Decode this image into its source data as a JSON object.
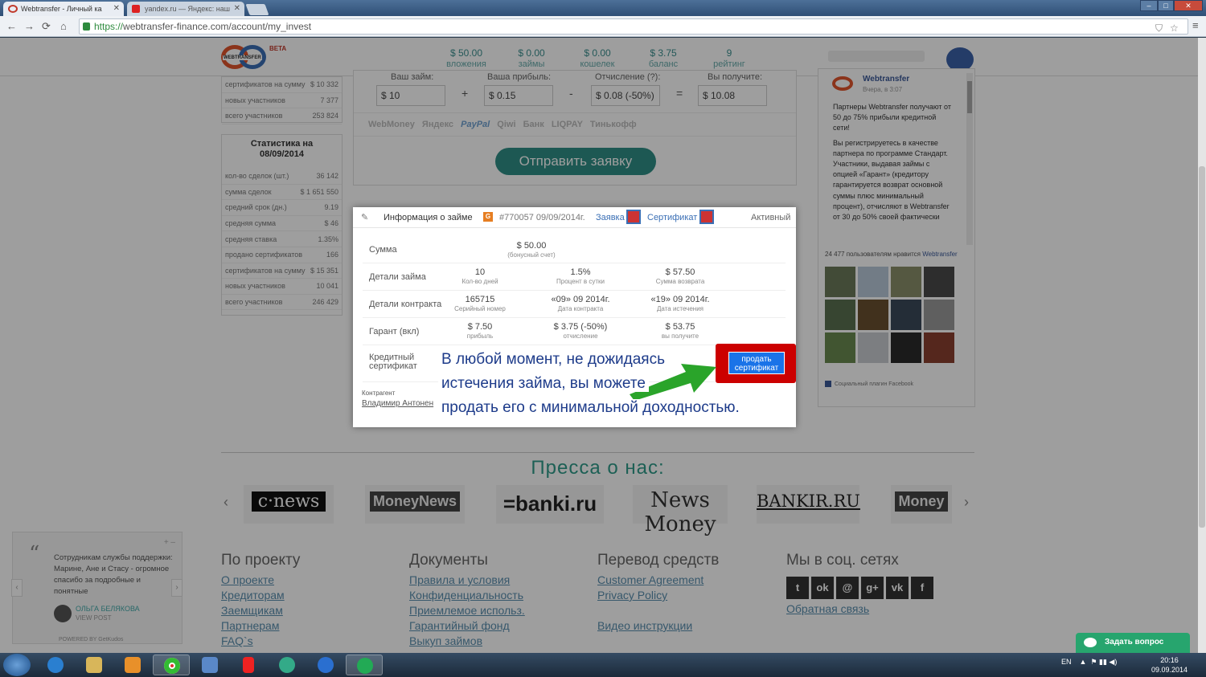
{
  "browser": {
    "tabs": [
      {
        "title": "Webtransfer - Личный ка"
      },
      {
        "title": "yandex.ru — Яндекс: наш"
      }
    ],
    "url_scheme": "https://",
    "url_rest": "webtransfer-finance.com/account/my_invest"
  },
  "header": {
    "logo_text": "WEBTRANSFER",
    "beta": "BETA",
    "stats": [
      {
        "value": "$ 50.00",
        "caption": "вложения"
      },
      {
        "value": "$ 0.00",
        "caption": "займы"
      },
      {
        "value": "$ 0.00",
        "caption": "кошелек"
      },
      {
        "value": "$ 3.75",
        "caption": "баланс"
      },
      {
        "value": "9",
        "caption": "рейтинг"
      }
    ]
  },
  "sidebar": {
    "top_rows": [
      {
        "label": "сертификатов на сумму",
        "value": "$ 10 332"
      },
      {
        "label": "новых участников",
        "value": "7 377"
      },
      {
        "label": "всего участников",
        "value": "253 824"
      }
    ],
    "stats_title": "Статистика на 08/09/2014",
    "rows": [
      {
        "label": "кол-во сделок (шт.)",
        "value": "36 142"
      },
      {
        "label": "сумма сделок",
        "value": "$ 1 651 550"
      },
      {
        "label": "средний срок (дн.)",
        "value": "9.19"
      },
      {
        "label": "средняя сумма",
        "value": "$ 46"
      },
      {
        "label": "средняя ставка",
        "value": "1.35%"
      },
      {
        "label": "продано сертификатов",
        "value": "166"
      },
      {
        "label": "сертификатов на сумму",
        "value": "$ 15 351"
      },
      {
        "label": "новых участников",
        "value": "10 041"
      },
      {
        "label": "всего участников",
        "value": "246 429"
      }
    ]
  },
  "form": {
    "labels": [
      "Ваш займ:",
      "Ваша прибыль:",
      "Отчисление (?):",
      "Вы получите:"
    ],
    "values": [
      "$ 10",
      "$ 0.15",
      "$ 0.08 (-50%)",
      "$ 10.08"
    ],
    "ops": [
      "+",
      "-",
      "="
    ],
    "payments": [
      "WebMoney",
      "Яндекс",
      "PayPal",
      "Qiwi",
      "Банк",
      "LIQPAY",
      "Тинькофф"
    ],
    "submit": "Отправить заявку"
  },
  "fb": {
    "name": "Webtransfer",
    "time": "Вчера, в 3:07",
    "p1": "Партнеры Webtransfer получают от 50 до 75% прибыли кредитной сети!",
    "p2": "Вы регистрируетесь в качестве партнера по программе Стандарт. Участники, выдавая займы с опцией «Гарант» (кредитору гарантируется возврат основной суммы плюс минимальный процент), отчисляют в Webtransfer от 30 до 50% своей фактически",
    "likes_prefix": "24 477 пользователям нравится ",
    "likes_link": "Webtransfer",
    "plugin": "Социальный плагин Facebook"
  },
  "modal": {
    "title": "Информация о займе",
    "badge": "G",
    "number": "#770057 09/09/2014г.",
    "link_request": "Заявка",
    "link_cert": "Сертификат",
    "status": "Активный",
    "sum_label": "Сумма",
    "sum_value": "$ 50.00",
    "sum_sub": "(бонусный счет)",
    "rows": [
      {
        "label": "Детали займа",
        "cells": [
          {
            "v": "10",
            "s": "Кол-во дней"
          },
          {
            "v": "1.5%",
            "s": "Процент в сутки"
          },
          {
            "v": "$ 57.50",
            "s": "Сумма возврата"
          }
        ]
      },
      {
        "label": "Детали контракта",
        "cells": [
          {
            "v": "165715",
            "s": "Серийный номер"
          },
          {
            "v": "«09» 09 2014г.",
            "s": "Дата контракта"
          },
          {
            "v": "«19» 09 2014г.",
            "s": "Дата истечения"
          }
        ]
      },
      {
        "label": "Гарант (вкл)",
        "cells": [
          {
            "v": "$ 7.50",
            "s": "прибыль"
          },
          {
            "v": "$ 3.75 (-50%)",
            "s": "отчисление"
          },
          {
            "v": "$ 53.75",
            "s": "вы получите"
          }
        ]
      }
    ],
    "credit_label_1": "Кредитный",
    "credit_label_2": "сертификат",
    "counterparty_label": "Контрагент",
    "counterparty_name": "Владимир Антонен",
    "sell_button_1": "продать",
    "sell_button_2": "сертификат"
  },
  "callout": {
    "line1": "В любой момент, не дожидаясь",
    "line2": "истечения займа, вы можете",
    "line3": "продать его с минимальной доходностью."
  },
  "press": {
    "title": "Пресса о нас:",
    "logos": [
      "c·news",
      "MoneyNews",
      "=banki.ru",
      "News Money",
      "BANKIR.RU",
      "Money"
    ]
  },
  "footer": {
    "col1": {
      "title": "По проекту",
      "links": [
        "О проекте",
        "Кредиторам",
        "Заемщикам",
        "Партнерам",
        "FAQ`s"
      ]
    },
    "col2": {
      "title": "Документы",
      "links": [
        "Правила и условия",
        "Конфиденциальность",
        "Приемлемое использ.",
        "Гарантийный фонд",
        "Выкуп займов"
      ]
    },
    "col3": {
      "title": "Перевод средств",
      "links": [
        "Customer Agreement",
        "Privacy Policy",
        "",
        "Видео инструкции"
      ]
    },
    "col4": {
      "title": "Мы в соц. сетях",
      "feedback": "Обратная связь"
    },
    "social": [
      "t",
      "ok",
      "@",
      "g+",
      "vk",
      "f"
    ]
  },
  "testimonial": {
    "text": "Сотрудникам службы поддержки: Марине, Ане и Стасу - огромное спасибо за подробные и понятные",
    "author": "ОЛЬГА БЕЛЯКОВА",
    "view": "VIEW POST",
    "powered": "POWERED BY GetKudos"
  },
  "ask": "Задать вопрос",
  "taskbar": {
    "lang": "EN",
    "time": "20:16",
    "date": "09.09.2014"
  }
}
